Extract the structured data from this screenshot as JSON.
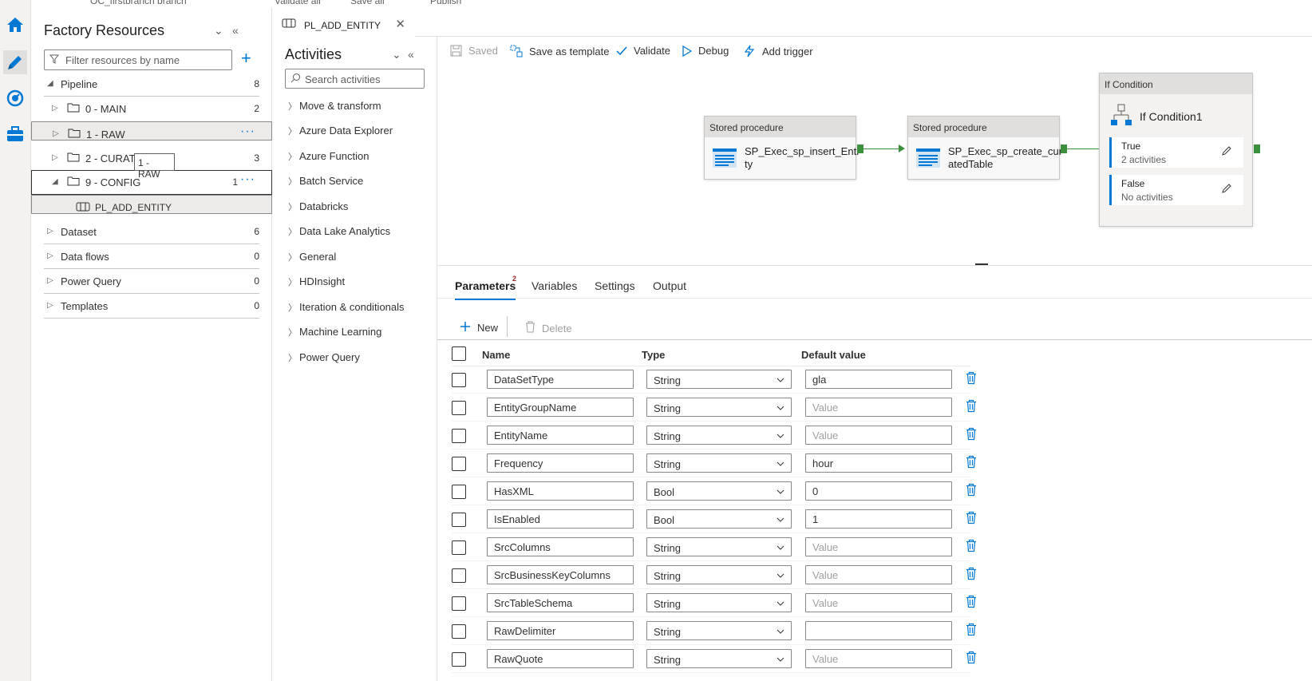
{
  "topbar": {
    "branch": "OC_firstbranch branch",
    "validate_all": "Validate all",
    "save_all": "Save all",
    "publish": "Publish"
  },
  "rail": [
    {
      "icon": "home-icon"
    },
    {
      "icon": "pencil-author-icon"
    },
    {
      "icon": "monitor-gauge-icon"
    },
    {
      "icon": "toolbox-manage-icon"
    }
  ],
  "resources": {
    "title": "Factory Resources",
    "filter_placeholder": "Filter resources by name",
    "pipeline": {
      "label": "Pipeline",
      "count": "8"
    },
    "folders": [
      {
        "label": "0 - MAIN",
        "count": "2"
      },
      {
        "label": "1 - RAW",
        "count": ""
      },
      {
        "label": "2 - CURATED",
        "count": "3"
      },
      {
        "label": "9 - CONFIG",
        "count": "1"
      }
    ],
    "pipeline_item": "PL_ADD_ENTITY",
    "tooltip": "1 - RAW",
    "sections": [
      {
        "label": "Dataset",
        "count": "6"
      },
      {
        "label": "Data flows",
        "count": "0"
      },
      {
        "label": "Power Query",
        "count": "0"
      },
      {
        "label": "Templates",
        "count": "0"
      }
    ]
  },
  "tab": {
    "label": "PL_ADD_ENTITY"
  },
  "activities": {
    "title": "Activities",
    "search_placeholder": "Search activities",
    "items": [
      "Move & transform",
      "Azure Data Explorer",
      "Azure Function",
      "Batch Service",
      "Databricks",
      "Data Lake Analytics",
      "General",
      "HDInsight",
      "Iteration & conditionals",
      "Machine Learning",
      "Power Query"
    ]
  },
  "toolbar": {
    "saved": "Saved",
    "save_template": "Save as template",
    "validate": "Validate",
    "debug": "Debug",
    "add_trigger": "Add trigger"
  },
  "canvas": {
    "node1": {
      "type": "Stored procedure",
      "name_line1": "SP_Exec_sp_insert_Enti",
      "name_line2": "ty"
    },
    "node2": {
      "type": "Stored procedure",
      "name_line1": "SP_Exec_sp_create_cur",
      "name_line2": "atedTable"
    },
    "ifnode": {
      "type": "If Condition",
      "name": "If Condition1",
      "true_label": "True",
      "true_sub": "2 activities",
      "false_label": "False",
      "false_sub": "No activities"
    }
  },
  "params_tabs": {
    "parameters": "Parameters",
    "badge": "2",
    "variables": "Variables",
    "settings": "Settings",
    "output": "Output"
  },
  "commands": {
    "new": "New",
    "delete": "Delete"
  },
  "grid": {
    "headers": {
      "name": "Name",
      "type": "Type",
      "default": "Default value"
    },
    "rows": [
      {
        "name": "DataSetType",
        "type": "String",
        "default": "gla",
        "placeholder": false
      },
      {
        "name": "EntityGroupName",
        "type": "String",
        "default": "Value",
        "placeholder": true
      },
      {
        "name": "EntityName",
        "type": "String",
        "default": "Value",
        "placeholder": true
      },
      {
        "name": "Frequency",
        "type": "String",
        "default": "hour",
        "placeholder": false
      },
      {
        "name": "HasXML",
        "type": "Bool",
        "default": "0",
        "placeholder": false
      },
      {
        "name": "IsEnabled",
        "type": "Bool",
        "default": "1",
        "placeholder": false
      },
      {
        "name": "SrcColumns",
        "type": "String",
        "default": "Value",
        "placeholder": true
      },
      {
        "name": "SrcBusinessKeyColumns",
        "type": "String",
        "default": "Value",
        "placeholder": true
      },
      {
        "name": "SrcTableSchema",
        "type": "String",
        "default": "Value",
        "placeholder": true
      },
      {
        "name": "RawDelimiter",
        "type": "String",
        "default": "",
        "placeholder": false
      },
      {
        "name": "RawQuote",
        "type": "String",
        "default": "Value",
        "placeholder": true
      }
    ]
  },
  "colors": {
    "accent": "#0078d4",
    "pipeline_green": "#3c8f3c"
  }
}
